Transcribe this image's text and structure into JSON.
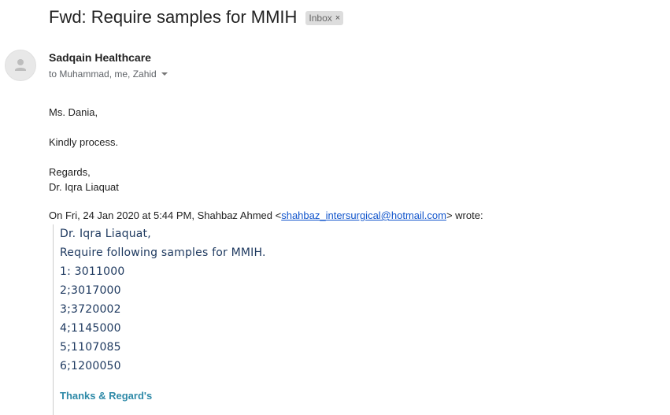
{
  "email": {
    "subject": "Fwd: Require samples for MMIH",
    "label": "Inbox",
    "label_close": "×",
    "sender_name": "Sadqain Healthcare",
    "recipients": "to Muhammad, me, Zahid"
  },
  "body": {
    "greeting": "Ms. Dania,",
    "line1": "Kindly process.",
    "signoff": "Regards,",
    "signature": "Dr. Iqra Liaquat"
  },
  "quoted": {
    "header_prefix": "On Fri, 24 Jan 2020 at 5:44 PM, Shahbaz Ahmed <",
    "email_link": "shahbaz_intersurgical@hotmail.com",
    "header_suffix": "> wrote:",
    "lines": [
      "Dr. Iqra Liaquat,",
      "Require following samples for MMIH.",
      "1: 3011000",
      "2;3017000",
      "3;3720002",
      "4;1145000",
      "5;1107085",
      "6;1200050"
    ],
    "closing": "Thanks & Regard's"
  },
  "colors": {
    "link": "#1155cc",
    "quote_text": "#1f3a60",
    "closing": "#2f8aa8"
  },
  "icons": {
    "avatar": "default-avatar-icon",
    "caret": "chevron-down-icon",
    "close": "close-icon"
  }
}
